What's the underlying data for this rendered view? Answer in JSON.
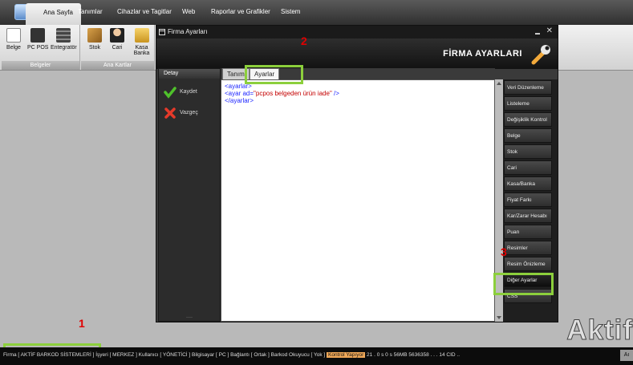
{
  "menubar": {
    "tabs": [
      "Ana Sayfa",
      "Tanımlar",
      "Cihazlar ve Tagitlar",
      "Web",
      "Raporlar ve Grafikler",
      "Sistem"
    ]
  },
  "toolbar": {
    "group1": {
      "caption": "Belgeler",
      "items": [
        "Belge",
        "PC POS",
        "Entegratör"
      ]
    },
    "group2": {
      "caption": "Ana Kartlar",
      "items": [
        "Stok",
        "Cari",
        "Kasa Banka"
      ]
    }
  },
  "dialog": {
    "title": "Firma Ayarları",
    "header_title": "FİRMA AYARLARI",
    "close_glyph": "✕",
    "minimize_glyph": "▬",
    "left_panel": {
      "title": "Detay",
      "actions": [
        "Kaydet",
        "Vazgeç"
      ],
      "grip": "····"
    },
    "tabs": [
      "Tanım",
      "Ayarlar"
    ],
    "editor": {
      "lines": [
        {
          "kw": "<ayarlar>"
        },
        {
          "pre": "<ayar ad=",
          "str": "\"pcpos belgeden ürün iade\"",
          "post": " />"
        },
        {
          "kw": "</ayarlar>"
        }
      ]
    },
    "right_panel": [
      "Veri Düzenleme",
      "Listeleme",
      "Değişiklik Kontrol",
      "Belge",
      "Stok",
      "Cari",
      "Kasa/Banka",
      "Fiyat Farkı",
      "Kar/Zarar Hesabı",
      "Puan",
      "Resimler",
      "Resim Önizleme",
      "Diğer Ayarlar",
      "CSS"
    ]
  },
  "annotations": [
    "1",
    "2",
    "3"
  ],
  "brand": "Aktif",
  "statusbar": {
    "part1": "Firma [ AKTİF BARKOD SİSTEMLERİ ]",
    "part2": "İşyeri [ MERKEZ ]  Kullanıcı [ YÖNETİCİ ]  Bilgisayar [ PC ]  Bağlantı [ Ortak ]  Barkod Okuyucu [ Yok ]",
    "warn": "Kontrol Yapıyor",
    "part3": "21  .  0 s  0 s  56MB  5636358  .  .  .  14  CID  ..",
    "corner": "Aı"
  }
}
